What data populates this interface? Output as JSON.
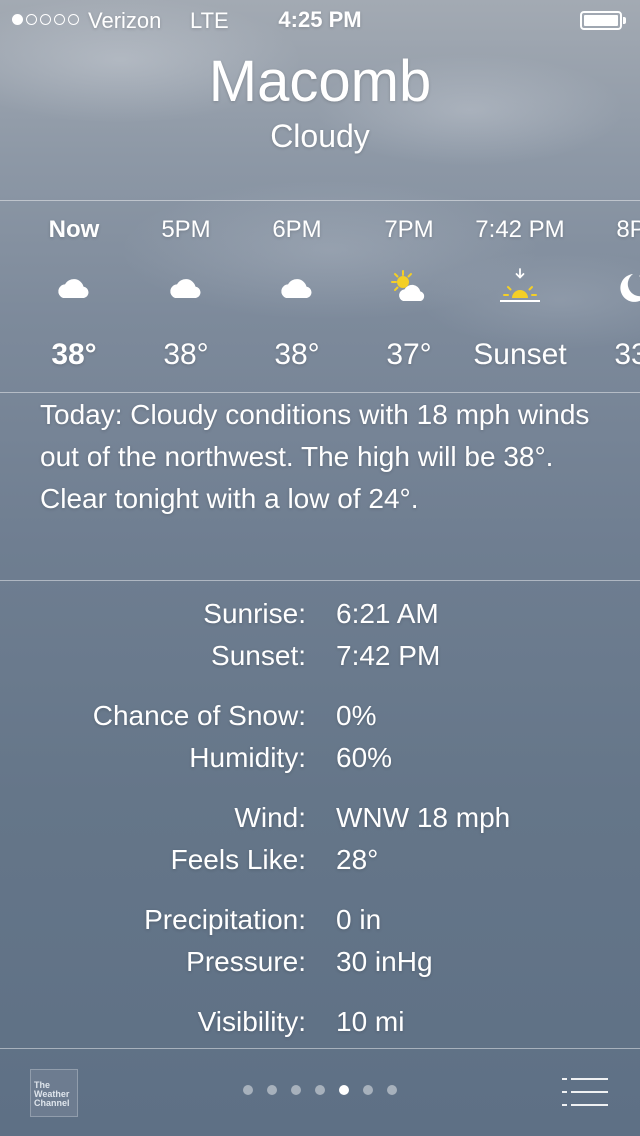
{
  "status_bar": {
    "carrier": "Verizon",
    "network": "LTE",
    "time": "4:25 PM",
    "signal_bars": 1,
    "signal_total": 5
  },
  "location": {
    "city": "Macomb",
    "condition": "Cloudy"
  },
  "hourly": [
    {
      "label": "Now",
      "icon": "cloud-icon",
      "temp": "38°",
      "bold": true
    },
    {
      "label": "5PM",
      "icon": "cloud-icon",
      "temp": "38°"
    },
    {
      "label": "6PM",
      "icon": "cloud-icon",
      "temp": "38°"
    },
    {
      "label": "7PM",
      "icon": "partly-sunny-icon",
      "temp": "37°"
    },
    {
      "label": "7:42 PM",
      "icon": "sunset-icon",
      "temp": "Sunset"
    },
    {
      "label": "8P",
      "icon": "moon-icon",
      "temp": "33"
    }
  ],
  "summary": "Today: Cloudy conditions with 18 mph winds out of the northwest. The high will be 38°. Clear tonight with a low of 24°.",
  "details": [
    {
      "label": "Sunrise:",
      "value": "6:21 AM"
    },
    {
      "label": "Sunset:",
      "value": "7:42 PM"
    },
    {
      "label": "Chance of Snow:",
      "value": "0%"
    },
    {
      "label": "Humidity:",
      "value": "60%"
    },
    {
      "label": "Wind:",
      "value": "WNW 18 mph"
    },
    {
      "label": "Feels Like:",
      "value": "28°"
    },
    {
      "label": "Precipitation:",
      "value": "0 in"
    },
    {
      "label": "Pressure:",
      "value": "30 inHg"
    },
    {
      "label": "Visibility:",
      "value": "10 mi"
    }
  ],
  "toolbar": {
    "logo_text": "The Weather Channel",
    "page_count": 7,
    "active_page": 5
  },
  "colors": {
    "sun": "#f4cf26",
    "text": "#ffffff"
  }
}
